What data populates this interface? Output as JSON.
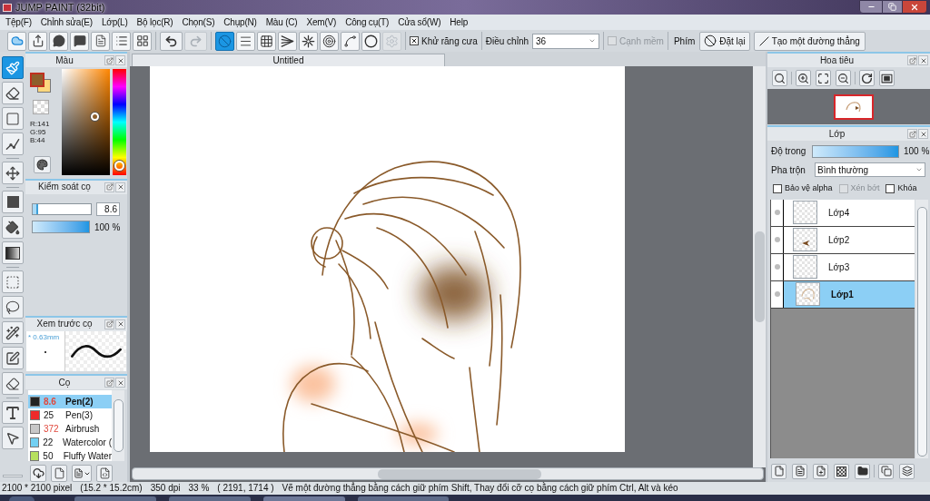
{
  "window": {
    "title": "JUMP PAINT (32bit)"
  },
  "menu": [
    "Tệp(F)",
    "Chỉnh sửa(E)",
    "Lớp(L)",
    "Bộ lọc(R)",
    "Chọn(S)",
    "Chụp(N)",
    "Màu (C)",
    "Xem(V)",
    "Công cụ(T)",
    "Cửa sổ(W)",
    "Help"
  ],
  "toolbar": {
    "file_buttons": [
      {
        "kind": "cloud"
      },
      {
        "kind": "share"
      },
      {
        "kind": "bubble"
      },
      {
        "kind": "comment"
      },
      {
        "kind": "page"
      },
      {
        "kind": "list"
      },
      {
        "kind": "grid_edit"
      }
    ],
    "history_buttons": [
      {
        "kind": "undo",
        "disabled": false
      },
      {
        "kind": "redo",
        "disabled": true
      }
    ],
    "rulers": [
      {
        "kind": "none",
        "selected": true,
        "disabled": false
      },
      {
        "kind": "parallel",
        "selected": false,
        "disabled": false
      },
      {
        "kind": "grid",
        "selected": false,
        "disabled": false
      },
      {
        "kind": "perspective",
        "selected": false,
        "disabled": false
      },
      {
        "kind": "radial",
        "selected": false,
        "disabled": false
      },
      {
        "kind": "concentric",
        "selected": false,
        "disabled": false
      },
      {
        "kind": "curve",
        "selected": false,
        "disabled": false
      },
      {
        "kind": "ellipse",
        "selected": false,
        "disabled": false
      },
      {
        "kind": "settings",
        "selected": false,
        "disabled": true
      }
    ],
    "antialias": {
      "label": "Khử răng cưa",
      "checked": true
    },
    "adjust": {
      "label": "Điều chỉnh",
      "value": "36"
    },
    "soft_edge": {
      "label": "Cạnh mềm",
      "checked": false,
      "disabled": true
    },
    "keys": {
      "label": "Phím",
      "reset": "Đặt lại",
      "straight_line": "Tạo một đường thẳng"
    }
  },
  "tools": [
    [
      {
        "kind": "brush",
        "selected": true
      },
      {
        "kind": "eraser",
        "selected": false
      },
      {
        "kind": "rectangle",
        "selected": false
      },
      {
        "kind": "polyline",
        "selected": false
      }
    ],
    [
      {
        "kind": "move",
        "selected": false
      }
    ],
    [
      {
        "kind": "fill",
        "selected": false
      },
      {
        "kind": "bucket",
        "selected": false
      },
      {
        "kind": "gradient",
        "selected": false
      }
    ],
    [
      {
        "kind": "rect_select",
        "selected": false
      },
      {
        "kind": "lasso",
        "selected": false
      },
      {
        "kind": "wand",
        "selected": false
      },
      {
        "kind": "select_pen",
        "selected": false
      },
      {
        "kind": "select_eraser",
        "selected": false
      }
    ],
    [
      {
        "kind": "text",
        "selected": false
      },
      {
        "kind": "select_move",
        "selected": false
      }
    ]
  ],
  "color": {
    "title": "Màu",
    "swatches": [
      {
        "kind": "background",
        "color": "#fcd77e"
      },
      {
        "kind": "foreground",
        "color": "#8d5f2c"
      }
    ],
    "readout": [
      "R:141",
      "G:95",
      "B:44"
    ]
  },
  "brush_control": {
    "title": "Kiểm soát cọ",
    "size": {
      "level": 0.09,
      "value": "8.6"
    },
    "opacity": {
      "level": 1,
      "reading": "100 %"
    }
  },
  "brush_preview": {
    "title": "Xem trước cọ",
    "size": "* 0.63mm"
  },
  "brushes": {
    "title": "Cọ",
    "items": [
      {
        "size": "8.6",
        "name": "Pen(2)",
        "color": "#222222",
        "size_alert": true,
        "selected": true
      },
      {
        "size": "25",
        "name": "Pen(3)",
        "color": "#ee2a2a",
        "size_alert": false,
        "selected": false
      },
      {
        "size": "372",
        "name": "Airbrush",
        "color": "#c8c8c8",
        "size_alert": true,
        "selected": false
      },
      {
        "size": "22",
        "name": "Watercolor (",
        "color": "#72d0f2",
        "size_alert": false,
        "selected": false
      },
      {
        "size": "50",
        "name": "Fluffy Water",
        "color": "#b6e05e",
        "size_alert": false,
        "selected": false
      }
    ],
    "buttons": [
      {
        "kind": "download"
      },
      {
        "kind": "new"
      },
      {
        "kind": "menu"
      },
      {
        "kind": "script"
      }
    ]
  },
  "canvas": {
    "tab": "Untitled"
  },
  "navigator": {
    "title": "Hoa tiêu",
    "button_groups": [
      [
        {
          "kind": "actual_size"
        }
      ],
      [
        {
          "kind": "zoom_in"
        },
        {
          "kind": "fit"
        },
        {
          "kind": "zoom_out"
        }
      ],
      [
        {
          "kind": "rotate"
        },
        {
          "kind": "flip"
        }
      ]
    ]
  },
  "layers": {
    "title": "Lớp",
    "opacity_label": "Độ trong",
    "opacity": {
      "level": 1,
      "reading": "100 %"
    },
    "blend_label": "Pha trộn",
    "blend": "Bình thường",
    "options": [
      {
        "label": "Bảo vệ alpha",
        "checked": false,
        "disabled": false
      },
      {
        "label": "Xén bớt",
        "checked": false,
        "disabled": true
      },
      {
        "label": "Khóa",
        "checked": false,
        "disabled": false
      }
    ],
    "items": [
      {
        "name": "Lớp4",
        "kind": "blank",
        "selected": false
      },
      {
        "name": "Lớp2",
        "kind": "mark",
        "selected": false
      },
      {
        "name": "Lớp3",
        "kind": "blank",
        "selected": false
      },
      {
        "name": "Lớp1",
        "kind": "sketch",
        "selected": true
      }
    ],
    "button_groups": [
      [
        {
          "kind": "page"
        },
        {
          "kind": "document"
        },
        {
          "kind": "add_page"
        },
        {
          "kind": "pattern"
        },
        {
          "kind": "folder"
        }
      ],
      [
        {
          "kind": "copy"
        },
        {
          "kind": "merge"
        }
      ]
    ]
  },
  "status_bar": [
    "2100 * 2100 pixel",
    "(15.2 * 15.2cm)",
    "350 dpi",
    "33 %",
    "( 2191, 1714 )",
    "Vẽ một đường thẳng bằng cách giữ phím Shift, Thay đổi cỡ cọ bằng cách giữ phím Ctrl, Alt và kéo"
  ]
}
